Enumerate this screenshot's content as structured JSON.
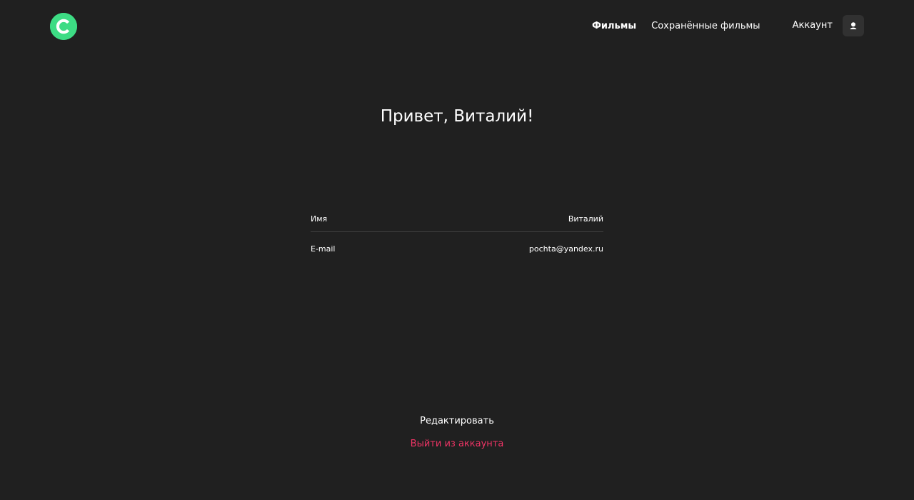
{
  "header": {
    "logo_icon": "logo-c-icon",
    "nav": {
      "movies_label": "Фильмы",
      "saved_movies_label": "Сохранённые фильмы"
    },
    "account_label": "Аккаунт",
    "account_icon": "user-icon"
  },
  "main": {
    "greeting": "Привет, Виталий!",
    "profile": {
      "name_label": "Имя",
      "name_value": "Виталий",
      "email_label": "E-mail",
      "email_value": "pochta@yandex.ru"
    },
    "edit_label": "Редактировать",
    "logout_label": "Выйти из аккаунта"
  },
  "colors": {
    "background": "#202020",
    "brand": "#3ddc84",
    "logout": "#ee3465",
    "account_icon_bg": "#313131",
    "divider": "#424242"
  }
}
